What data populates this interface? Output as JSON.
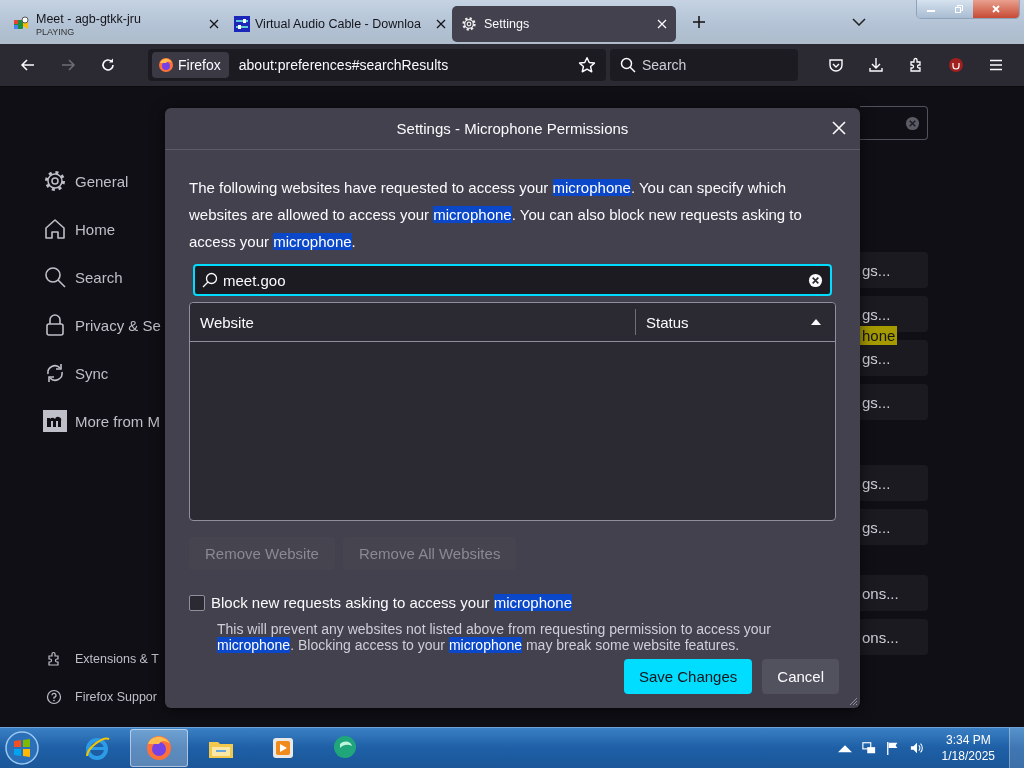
{
  "tabs": [
    {
      "title": "Meet - agb-gtkk-jru",
      "subtitle": "PLAYING",
      "kind": "meet",
      "selected": false
    },
    {
      "title": "Virtual Audio Cable - Downloa",
      "kind": "vac",
      "selected": false
    },
    {
      "title": "Settings",
      "kind": "gear",
      "selected": true
    }
  ],
  "navbar": {
    "identity": "Firefox",
    "url": "about:preferences#searchResults",
    "search_placeholder": "Search",
    "forward_disabled": true
  },
  "sidebar": {
    "items": [
      {
        "label": "General",
        "kind": "gear"
      },
      {
        "label": "Home",
        "kind": "home"
      },
      {
        "label": "Search",
        "kind": "search"
      },
      {
        "label": "Privacy & Se",
        "kind": "lock"
      },
      {
        "label": "Sync",
        "kind": "sync"
      },
      {
        "label": "More from M",
        "kind": "mozilla"
      }
    ],
    "footer": [
      {
        "label": "Extensions & T",
        "kind": "puzzle"
      },
      {
        "label": "Firefox Suppor",
        "kind": "help"
      }
    ]
  },
  "background": {
    "groups": [
      [
        "gs...",
        "gs...",
        "gs...",
        "gs..."
      ],
      [
        "gs...",
        "gs..."
      ],
      [
        "ons...",
        "ons..."
      ]
    ],
    "highlight": "hone"
  },
  "dialog": {
    "title": "Settings - Microphone Permissions",
    "description": [
      {
        "text": "The following websites have requested to access your ",
        "highlighted": false
      },
      {
        "text": "microphone",
        "highlighted": true
      },
      {
        "text": ". You can specify which websites are allowed to access your ",
        "highlighted": false
      },
      {
        "text": "microphone",
        "highlighted": true
      },
      {
        "text": ". You can also block new requests asking to access your ",
        "highlighted": false
      },
      {
        "text": "microphone",
        "highlighted": true
      },
      {
        "text": ".",
        "highlighted": false
      }
    ],
    "search": {
      "value": "meet.goo"
    },
    "columns": [
      {
        "label": "Website",
        "sorted": false
      },
      {
        "label": "Status",
        "sorted": true
      }
    ],
    "buttons": [
      {
        "label": "Remove Website",
        "disabled": true
      },
      {
        "label": "Remove All Websites",
        "disabled": true
      }
    ],
    "block_checkbox": {
      "checked": false,
      "label": [
        {
          "text": "Block new requests asking to access your ",
          "highlighted": false
        },
        {
          "text": "microphone",
          "highlighted": true
        }
      ]
    },
    "note": [
      {
        "text": "This will prevent any websites not listed above from requesting permission to access your ",
        "highlighted": false
      },
      {
        "text": "microphone",
        "highlighted": true
      },
      {
        "text": ". Blocking access to your ",
        "highlighted": false
      },
      {
        "text": "microphone",
        "highlighted": true
      },
      {
        "text": " may break some website features.",
        "highlighted": false
      }
    ],
    "actions": [
      {
        "label": "Save Changes",
        "kind": "primary"
      },
      {
        "label": "Cancel",
        "kind": "secondary"
      }
    ]
  },
  "taskbar": {
    "apps": [
      {
        "kind": "ie",
        "selected": false
      },
      {
        "kind": "firefox",
        "selected": true
      },
      {
        "kind": "explorer",
        "selected": false
      },
      {
        "kind": "media",
        "selected": false
      },
      {
        "kind": "chat",
        "selected": false
      }
    ],
    "time": "3:34 PM",
    "date": "1/18/2025"
  }
}
